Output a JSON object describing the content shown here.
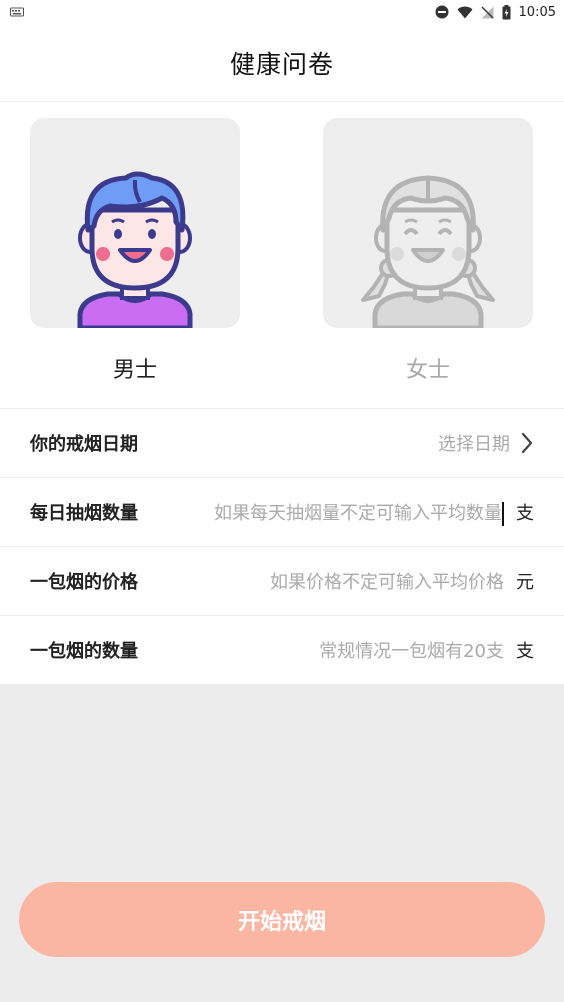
{
  "status_bar": {
    "time": "10:05",
    "icons": [
      "keyboard-icon",
      "do-not-disturb-icon",
      "wifi-icon",
      "no-signal-icon",
      "battery-charging-icon"
    ]
  },
  "header": {
    "title": "健康问卷"
  },
  "gender": {
    "male": {
      "label": "男士",
      "selected": true
    },
    "female": {
      "label": "女士",
      "selected": false
    }
  },
  "form": {
    "quit_date": {
      "label": "你的戒烟日期",
      "placeholder": "选择日期"
    },
    "daily_count": {
      "label": "每日抽烟数量",
      "placeholder": "如果每天抽烟量不定可输入平均数量",
      "unit": "支"
    },
    "pack_price": {
      "label": "一包烟的价格",
      "placeholder": "如果价格不定可输入平均价格",
      "unit": "元"
    },
    "pack_count": {
      "label": "一包烟的数量",
      "placeholder": "常规情况一包烟有20支",
      "unit": "支"
    }
  },
  "start_button": {
    "label": "开始戒烟"
  },
  "colors": {
    "accent": "#fbb5a3",
    "male_hair": "#6f9df5",
    "male_shirt": "#c96ef2",
    "outline": "#3c3a8c",
    "placeholder": "#aaaaaa"
  }
}
